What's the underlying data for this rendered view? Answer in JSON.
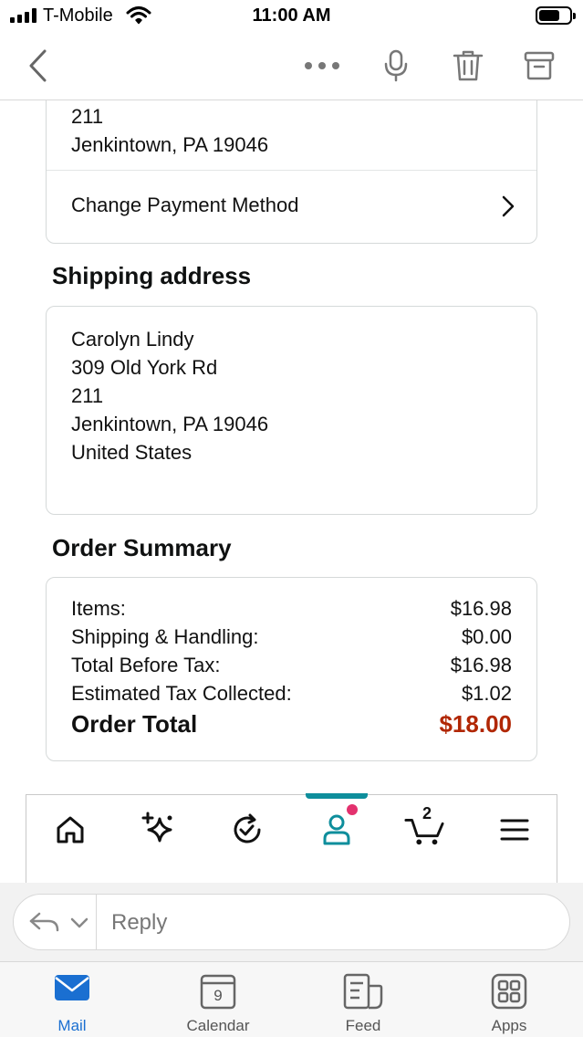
{
  "status_bar": {
    "carrier": "T-Mobile",
    "time": "11:00 AM"
  },
  "top_nav": {
    "icons": [
      "back-chevron-icon",
      "more-dots-icon",
      "microphone-icon",
      "trash-icon",
      "archive-icon"
    ]
  },
  "payment": {
    "address_lines": [
      "211",
      "Jenkintown, PA 19046"
    ],
    "change_label": "Change Payment Method"
  },
  "shipping": {
    "title": "Shipping address",
    "lines": [
      "Carolyn Lindy",
      "309 Old York Rd",
      "211",
      "Jenkintown, PA 19046",
      "United States"
    ]
  },
  "summary": {
    "title": "Order Summary",
    "rows": [
      {
        "label": "Items:",
        "value": "$16.98"
      },
      {
        "label": "Shipping & Handling:",
        "value": "$0.00"
      },
      {
        "label": "Total Before Tax:",
        "value": "$16.98"
      },
      {
        "label": "Estimated Tax Collected:",
        "value": "$1.02"
      }
    ],
    "total": {
      "label": "Order Total",
      "value": "$18.00"
    }
  },
  "app_bar": {
    "icons": [
      "home-icon",
      "sparkle-icon",
      "refresh-check-icon",
      "account-icon",
      "cart-icon",
      "menu-icon"
    ],
    "cart_count": "2"
  },
  "reply": {
    "placeholder": "Reply"
  },
  "tab_bar": {
    "tabs": [
      {
        "label": "Mail",
        "icon": "mail-icon"
      },
      {
        "label": "Calendar",
        "icon": "calendar-icon",
        "day": "9"
      },
      {
        "label": "Feed",
        "icon": "feed-icon"
      },
      {
        "label": "Apps",
        "icon": "apps-icon"
      }
    ],
    "active_tab": "Mail"
  },
  "colors": {
    "accent_blue": "#1a6fd1",
    "order_total": "#b12704",
    "active_teal": "#0e8e9c",
    "notification_dot": "#e3316e"
  }
}
